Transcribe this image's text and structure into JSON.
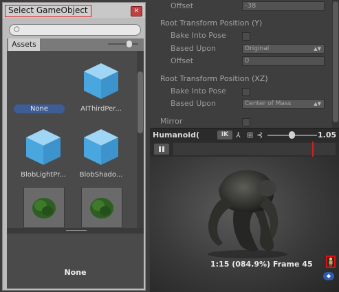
{
  "inspector": {
    "rows": [
      {
        "label": "Offset",
        "value": "-38",
        "kind": "field"
      },
      {
        "label": "Root Transform Position (Y)",
        "kind": "section"
      },
      {
        "label": "Bake Into Pose",
        "kind": "check"
      },
      {
        "label": "Based Upon",
        "value": "Original",
        "kind": "dropdown"
      },
      {
        "label": "Offset",
        "value": "0",
        "kind": "field"
      },
      {
        "label": "Root Transform Position (XZ)",
        "kind": "section"
      },
      {
        "label": "Bake Into Pose",
        "kind": "check"
      },
      {
        "label": "Based Upon",
        "value": "Center of Mass",
        "kind": "dropdown"
      },
      {
        "label": "Mirror",
        "kind": "check"
      }
    ]
  },
  "preview": {
    "title": "Humanoid(",
    "ik_label": "IK",
    "speed": "1.05",
    "frame_info": "1:15 (084.9%) Frame 45"
  },
  "picker": {
    "title": "Select GameObject",
    "close_glyph": "×",
    "search_value": "",
    "tab_label": "Assets",
    "items": [
      {
        "label": "None",
        "kind": "none",
        "selected": true
      },
      {
        "label": "AIThirdPer...",
        "kind": "cube"
      },
      {
        "label": "BlobLightPr...",
        "kind": "cube"
      },
      {
        "label": "BlobShado...",
        "kind": "cube"
      },
      {
        "label": "",
        "kind": "texture"
      },
      {
        "label": "",
        "kind": "texture"
      }
    ],
    "selected_name": "None"
  },
  "colors": {
    "selection": "#3d5d97",
    "highlight_box": "#e01010",
    "playhead": "#d02020",
    "cube": "#5ab4e8"
  }
}
